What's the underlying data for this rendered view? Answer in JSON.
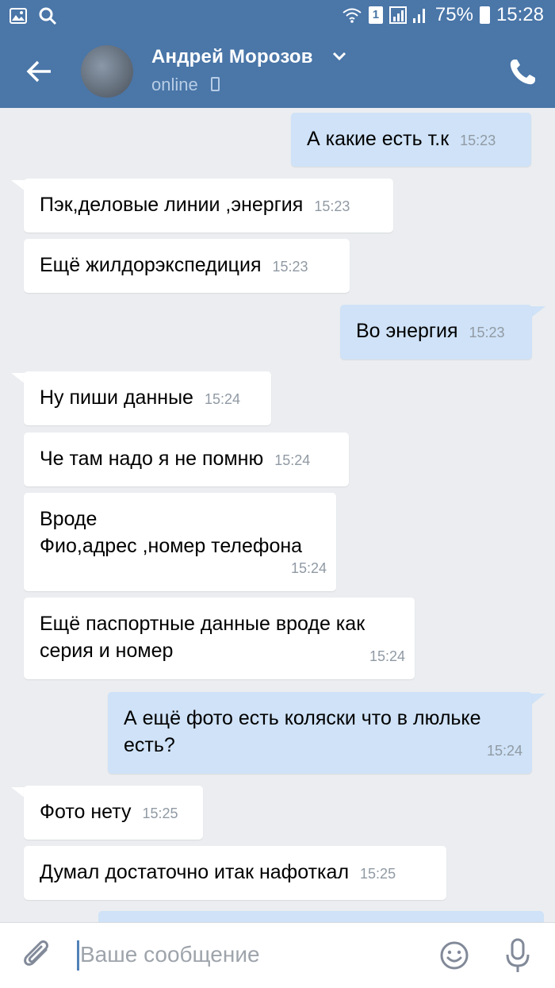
{
  "status_bar": {
    "sim_slot": "1",
    "battery": "75%",
    "time": "15:28"
  },
  "header": {
    "contact_name": "Андрей Морозов",
    "presence": "online"
  },
  "messages": [
    {
      "direction": "out",
      "text": "А какие есть т.к",
      "time": "15:23"
    },
    {
      "direction": "in",
      "text": "Пэк,деловые линии ,энергия",
      "time": "15:23"
    },
    {
      "direction": "in",
      "text": "Ещё жилдорэкспедиция",
      "time": "15:23"
    },
    {
      "direction": "out",
      "text": "Во энергия",
      "time": "15:23"
    },
    {
      "direction": "in",
      "text": "Ну пиши данные",
      "time": "15:24"
    },
    {
      "direction": "in",
      "text": "Че там надо я не помню",
      "time": "15:24"
    },
    {
      "direction": "in",
      "line1": "Вроде",
      "line2": "Фио,адрес ,номер телефона",
      "time": "15:24"
    },
    {
      "direction": "in",
      "line1": "Ещё паспортные данные вроде как",
      "line2": "серия и номер",
      "time": "15:24"
    },
    {
      "direction": "out",
      "line1": "А ещё фото есть коляски что в люльке",
      "line2": "есть?",
      "time": "15:24"
    },
    {
      "direction": "in",
      "text": "Фото нету",
      "time": "15:25"
    },
    {
      "direction": "in",
      "text": "Думал достаточно итак нафоткал",
      "time": "15:25"
    }
  ],
  "composer": {
    "placeholder": "Ваше сообщение"
  },
  "icons": {
    "status_left": [
      "gallery-icon",
      "search-icon"
    ],
    "status_right": [
      "wifi-icon",
      "sim-icon",
      "signal-icon",
      "battery-icon"
    ],
    "header": [
      "back-arrow-icon",
      "chevron-down-icon",
      "mobile-phone-icon",
      "phone-call-icon"
    ],
    "composer": [
      "paperclip-icon",
      "emoji-icon",
      "microphone-icon"
    ]
  },
  "colors": {
    "header": "#4a76a8",
    "chat_background": "#ebedf0",
    "incoming_bubble": "#ffffff",
    "outgoing_bubble": "#cfe2f7",
    "presence_text": "#b7cde6",
    "timestamp": "#909aa4"
  }
}
